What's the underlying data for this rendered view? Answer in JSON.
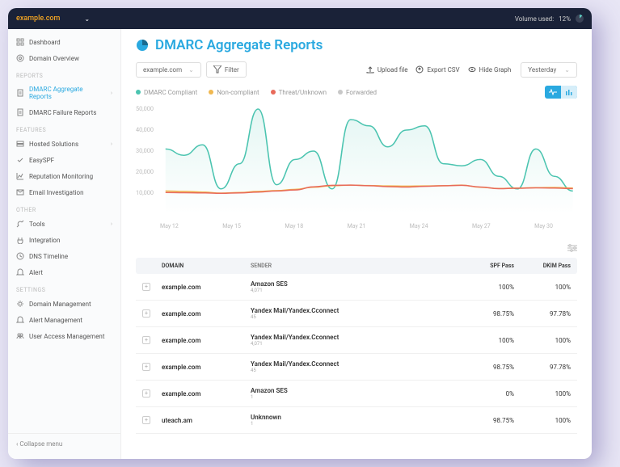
{
  "topbar": {
    "domain": "example.com",
    "volume_label": "Volume used:",
    "volume_pct": "12%"
  },
  "sidebar": {
    "items": [
      {
        "label": "Dashboard",
        "icon": "grid"
      },
      {
        "label": "Domain Overview",
        "icon": "target"
      }
    ],
    "reports_header": "REPORTS",
    "reports": [
      {
        "label": "DMARC Aggregate Reports",
        "icon": "report",
        "active": true,
        "chev": true
      },
      {
        "label": "DMARC Failure Reports",
        "icon": "report"
      }
    ],
    "features_header": "FEATURES",
    "features": [
      {
        "label": "Hosted Solutions",
        "icon": "server",
        "chev": true
      },
      {
        "label": "EasySPF",
        "icon": "check"
      },
      {
        "label": "Reputation Monitoring",
        "icon": "chart"
      },
      {
        "label": "Email Investigation",
        "icon": "mail"
      }
    ],
    "other_header": "OTHER",
    "other": [
      {
        "label": "Tools",
        "icon": "wrench",
        "chev": true
      },
      {
        "label": "Integration",
        "icon": "plug"
      },
      {
        "label": "DNS Timeline",
        "icon": "clock"
      },
      {
        "label": "Alert",
        "icon": "bell"
      }
    ],
    "settings_header": "SETTINGS",
    "settings": [
      {
        "label": "Domain Management",
        "icon": "gear"
      },
      {
        "label": "Alert Management",
        "icon": "bell"
      },
      {
        "label": "User Access Management",
        "icon": "users"
      }
    ],
    "collapse": "Collapse menu"
  },
  "page": {
    "title": "DMARC Aggregate Reports"
  },
  "toolbar": {
    "domain_value": "example.com",
    "filter": "Filter",
    "upload": "Upload file",
    "export": "Export CSV",
    "hide_graph": "Hide Graph",
    "date": "Yesterday"
  },
  "legend": [
    {
      "label": "DMARC Compliant",
      "color": "#4bc4b0"
    },
    {
      "label": "Non-compliant",
      "color": "#f0b850"
    },
    {
      "label": "Threat/Unknown",
      "color": "#e86a5a"
    },
    {
      "label": "Forwarded",
      "color": "#c8c8c8"
    }
  ],
  "chart_data": {
    "type": "line",
    "ylabel": "",
    "xlabel": "",
    "ylim": [
      0,
      50000
    ],
    "yticks": [
      10000,
      20000,
      30000,
      40000,
      50000
    ],
    "ytick_labels": [
      "10,000",
      "20,000",
      "30,000",
      "40,000",
      "50,000"
    ],
    "categories": [
      "May 12",
      "May 15",
      "May 18",
      "May 21",
      "May 24",
      "May 27",
      "May 30"
    ],
    "series": [
      {
        "name": "DMARC Compliant",
        "color": "#4bc4b0",
        "values": [
          31000,
          28000,
          33000,
          12000,
          24000,
          50000,
          14000,
          26000,
          30000,
          12000,
          45000,
          42000,
          32000,
          40000,
          42000,
          24000,
          23000,
          26000,
          18000,
          12000,
          31000,
          18000,
          11000
        ]
      },
      {
        "name": "Non-compliant",
        "color": "#f0b850",
        "values": [
          11000,
          10800,
          10500,
          10000,
          10300,
          10800,
          11200,
          11800,
          12800,
          13500,
          13800,
          13600,
          13400,
          13300,
          13400,
          13500,
          13800,
          12800,
          12200,
          12400,
          12600,
          12700,
          12400
        ]
      },
      {
        "name": "Threat/Unknown",
        "color": "#e86a5a",
        "values": [
          10300,
          10200,
          10100,
          9900,
          10100,
          10500,
          11000,
          11500,
          13000,
          13700,
          13800,
          13500,
          13100,
          12900,
          13200,
          13500,
          13700,
          12900,
          12100,
          12300,
          12500,
          12400,
          12100
        ]
      }
    ]
  },
  "table": {
    "headers": {
      "domain": "DOMAIN",
      "sender": "SENDER",
      "spf": "SPF Pass",
      "dkim": "DKIM Pass"
    },
    "rows": [
      {
        "domain": "example.com",
        "sender": "Amazon SES",
        "count": "4,071",
        "spf": "100%",
        "dkim": "100%"
      },
      {
        "domain": "example.com",
        "sender": "Yandex Mail/Yandex.Cconnect",
        "count": "45",
        "spf": "98.75%",
        "dkim": "97.78%"
      },
      {
        "domain": "example.com",
        "sender": "Yandex Mail/Yandex.Cconnect",
        "count": "4,071",
        "spf": "100%",
        "dkim": "100%"
      },
      {
        "domain": "example.com",
        "sender": "Yandex Mail/Yandex.Cconnect",
        "count": "45",
        "spf": "98.75%",
        "dkim": "97.78%"
      },
      {
        "domain": "example.com",
        "sender": "Amazon SES",
        "count": "1",
        "spf": "0%",
        "dkim": "100%"
      },
      {
        "domain": "uteach.am",
        "sender": "Unknnown",
        "count": "1",
        "spf": "98.75%",
        "dkim": "100%"
      }
    ]
  }
}
